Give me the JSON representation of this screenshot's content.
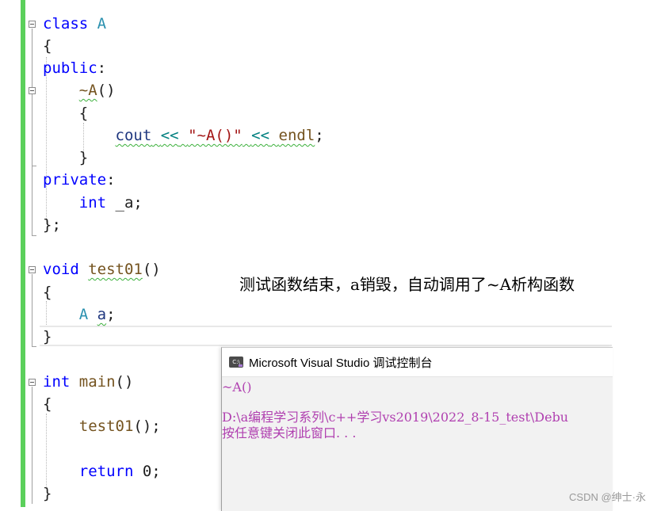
{
  "editor": {
    "lines": {
      "l1": {
        "kw": "class",
        "name": "A"
      },
      "l2": {
        "text": "{"
      },
      "l3": {
        "kw": "public",
        "colon": ":"
      },
      "l4": {
        "fn": "~A",
        "paren": "()"
      },
      "l5": {
        "text": "{"
      },
      "l6": {
        "ident": "cout",
        "op1": "<<",
        "str": "\"~A()\"",
        "op2": "<<",
        "endl": "endl",
        "semi": ";"
      },
      "l7": {
        "text": "}"
      },
      "l8": {
        "kw": "private",
        "colon": ":"
      },
      "l9": {
        "kw": "int",
        "rest": "_a;"
      },
      "l10": {
        "text": "};"
      },
      "l11": {
        "kw": "void",
        "fn": "test01",
        "paren": "()"
      },
      "l12": {
        "text": "{"
      },
      "l13": {
        "ty": "A",
        "var": "a",
        "semi": ";"
      },
      "l14": {
        "text": "}"
      },
      "l15": {
        "kw": "int",
        "fn": "main",
        "paren": "()"
      },
      "l16": {
        "text": "{"
      },
      "l17": {
        "fn": "test01",
        "rest": "();"
      },
      "l18": {
        "kw": "return",
        "rest": "0;"
      },
      "l19": {
        "text": "}"
      }
    }
  },
  "annotation": "测试函数结束，a销毁，自动调用了~A析构函数",
  "console": {
    "title": "Microsoft Visual Studio 调试控制台",
    "icon": "console-app-icon",
    "icon_text": "C:\\",
    "output_line1": "~A()",
    "output_line2": "D:\\a编程学习系列\\c++学习vs2019\\2022_8-15_test\\Debu",
    "output_line3": "按任意键关闭此窗口. . ."
  },
  "watermark": "CSDN @绅士·永",
  "colors": {
    "keyword": "#0000ff",
    "type": "#2b91af",
    "function": "#74531f",
    "string": "#a31515",
    "operator": "#008080",
    "console_text": "#b040b0",
    "change_bar": "#5bd05b"
  }
}
